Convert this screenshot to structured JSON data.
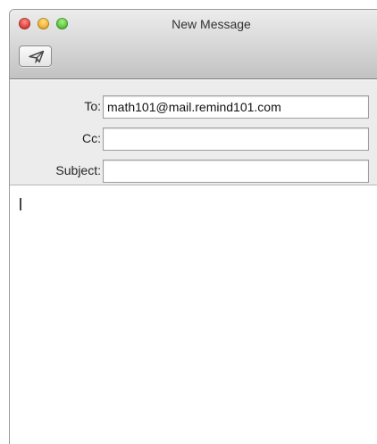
{
  "window": {
    "title": "New Message"
  },
  "toolbar": {
    "send_icon": "send-icon"
  },
  "fields": {
    "to_label": "To:",
    "to_value": "math101@mail.remind101.com",
    "cc_label": "Cc:",
    "cc_value": "",
    "subject_label": "Subject:",
    "subject_value": ""
  },
  "body": {
    "text": ""
  },
  "colors": {
    "close": "#e0443e",
    "minimize": "#f2b233",
    "zoom": "#5ec73d"
  }
}
